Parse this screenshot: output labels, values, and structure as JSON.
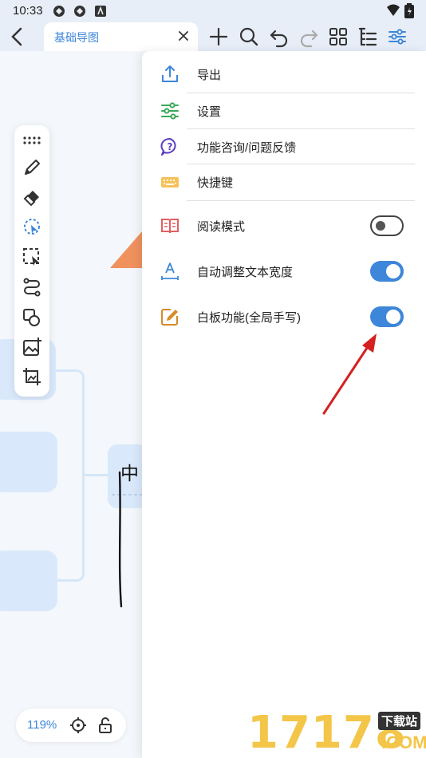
{
  "status_bar": {
    "time": "10:33"
  },
  "tab": {
    "label": "基础导图"
  },
  "menu": {
    "items": [
      {
        "label": "导出",
        "icon": "export-icon"
      },
      {
        "label": "设置",
        "icon": "settings-sliders-icon"
      },
      {
        "label": "功能咨询/问题反馈",
        "icon": "question-icon"
      },
      {
        "label": "快捷键",
        "icon": "keyboard-icon"
      }
    ],
    "toggles": [
      {
        "label": "阅读模式",
        "icon": "book-icon",
        "on": false
      },
      {
        "label": "自动调整文本宽度",
        "icon": "text-width-icon",
        "on": true
      },
      {
        "label": "白板功能(全局手写)",
        "icon": "whiteboard-pen-icon",
        "on": true
      }
    ]
  },
  "canvas": {
    "center_text": "中",
    "zoom": "119%"
  },
  "watermark": {
    "text": "17178",
    "sub": "下载站",
    "domain": ".COM"
  },
  "colors": {
    "accent": "#3d86d9",
    "node": "#d9e9fb",
    "orange": "#f0925e",
    "arrow": "#d42020"
  }
}
